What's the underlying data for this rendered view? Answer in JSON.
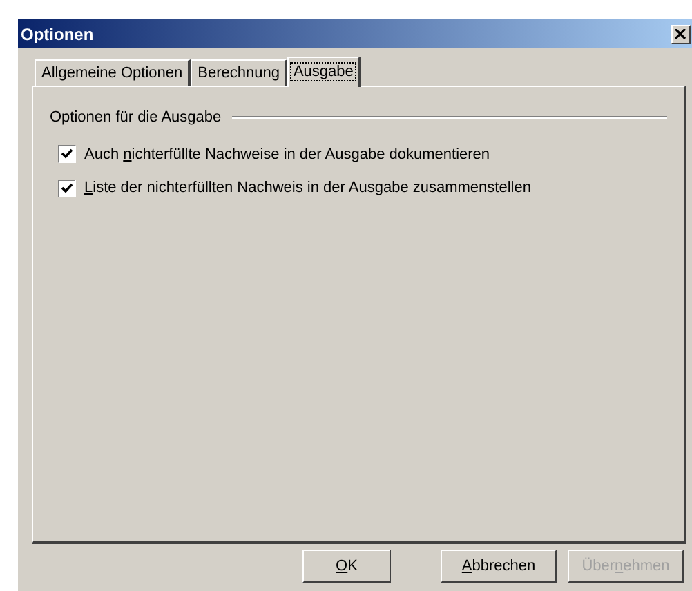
{
  "window": {
    "title": "Optionen"
  },
  "tabs": [
    {
      "label": "Allgemeine Optionen",
      "selected": false
    },
    {
      "label": "Berechnung",
      "selected": false
    },
    {
      "label": "Ausgabe",
      "selected": true
    }
  ],
  "group": {
    "title": "Optionen für die Ausgabe"
  },
  "options": [
    {
      "label": {
        "before": "Auch ",
        "key": "n",
        "after": "ichterfüllte Nachweise in der Ausgabe dokumentieren"
      },
      "checked": true
    },
    {
      "label": {
        "key": "L",
        "after": "iste der nichterfüllten Nachweis in der Ausgabe zusammenstellen"
      },
      "checked": true
    }
  ],
  "buttons": [
    {
      "label": {
        "key": "O",
        "after": "K"
      },
      "disabled": false
    },
    {
      "label": {
        "key": "A",
        "after": "bbrechen"
      },
      "disabled": false
    },
    {
      "label": {
        "before": "Über",
        "key": "n",
        "after": "ehmen"
      },
      "disabled": true
    }
  ]
}
